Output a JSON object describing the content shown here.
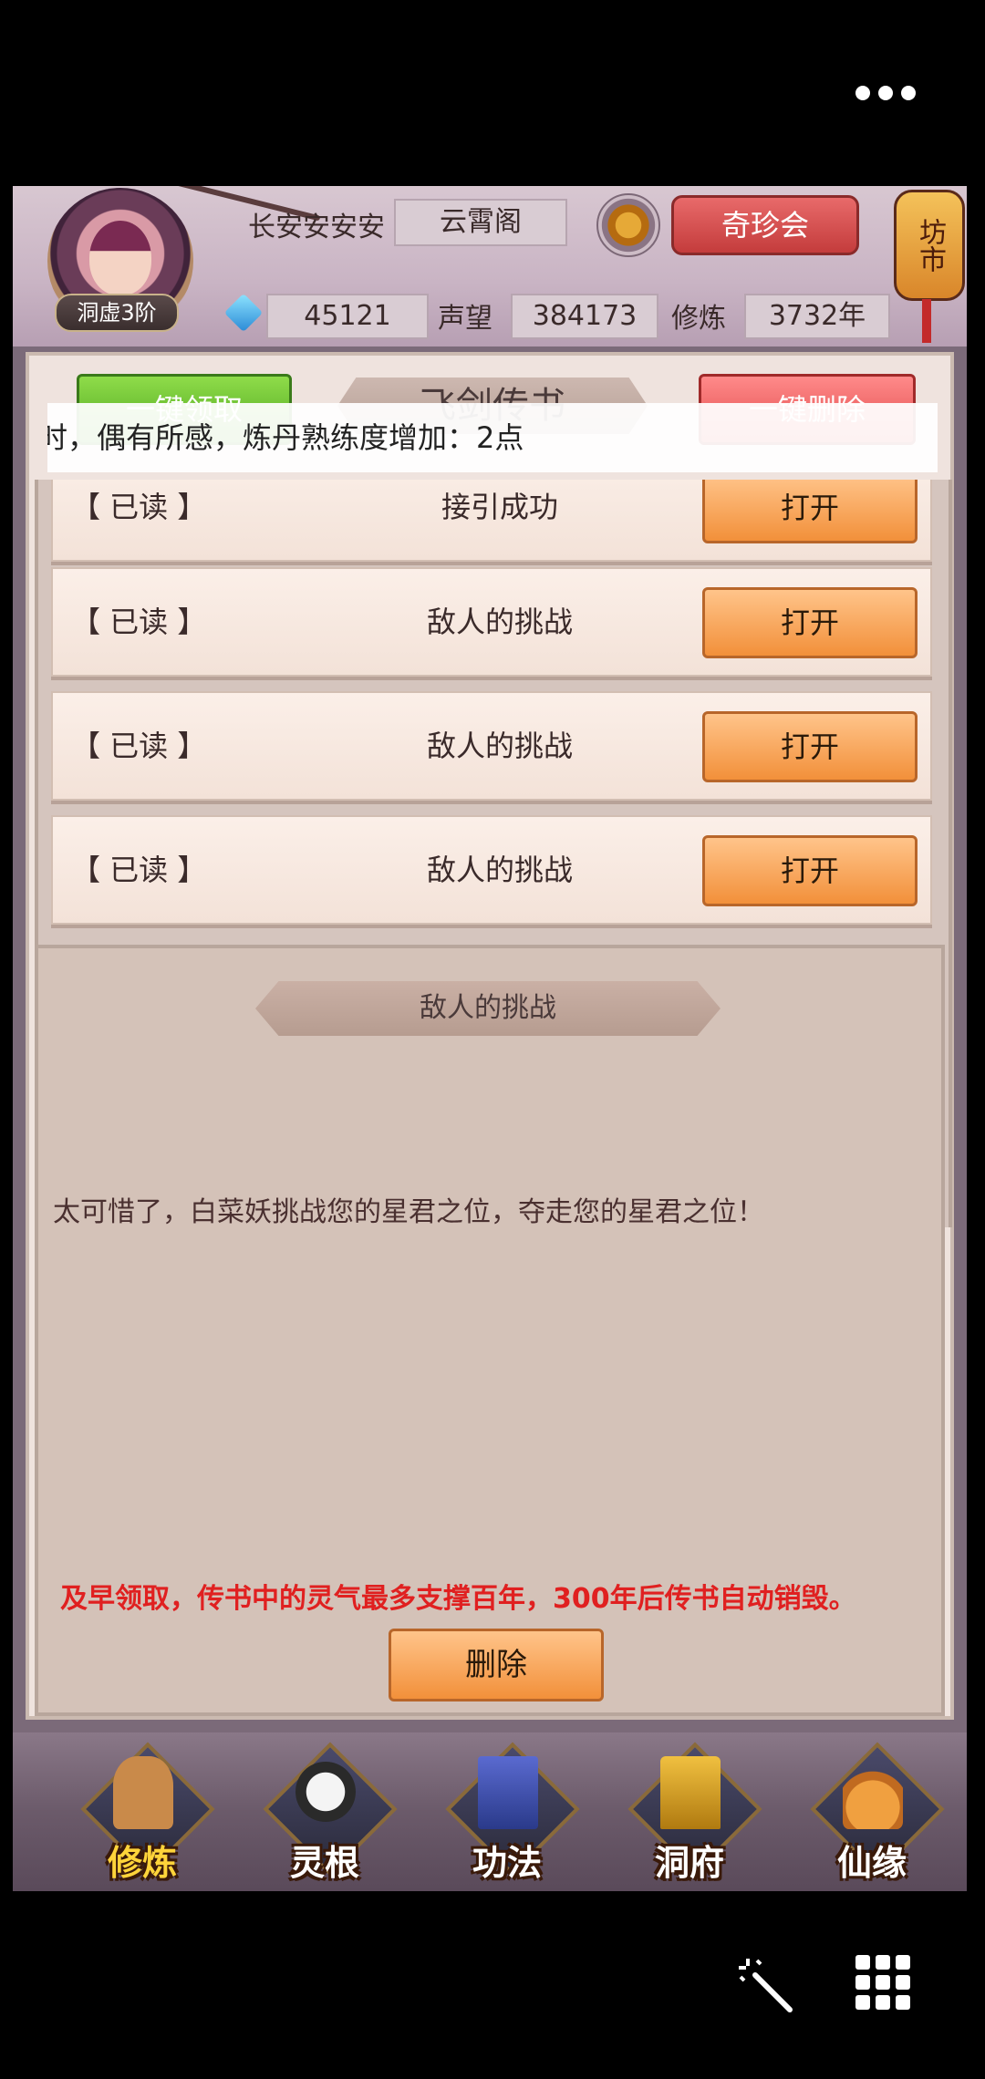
{
  "system": {
    "more_icon": "more-dots-icon"
  },
  "header": {
    "rank": "洞虚3阶",
    "player_name": "长安安安安",
    "guild": "云霄阁",
    "shop_button": "奇珍会",
    "market_label": "坊市",
    "spirit_stones": "45121",
    "prestige_label": "声望",
    "prestige": "384173",
    "cultivation_label": "修炼",
    "cultivation_years": "3732年"
  },
  "mail": {
    "title": "飞剑传书",
    "claim_all": "一键领取",
    "delete_all": "一键删除",
    "toast": "时，偶有所感，炼丹熟练度增加：2点",
    "items": [
      {
        "status": "【 已读 】",
        "subject": "接引成功",
        "action": "打开"
      },
      {
        "status": "【 已读 】",
        "subject": "敌人的挑战",
        "action": "打开"
      },
      {
        "status": "【 已读 】",
        "subject": "敌人的挑战",
        "action": "打开"
      },
      {
        "status": "【 已读 】",
        "subject": "敌人的挑战",
        "action": "打开"
      }
    ],
    "detail": {
      "title": "敌人的挑战",
      "body": "太可惜了，白菜妖挑战您的星君之位，夺走您的星君之位！",
      "warning": "及早领取，传书中的灵气最多支撑百年，300年后传书自动销毁。",
      "delete": "删除"
    }
  },
  "nav": [
    {
      "label": "修炼",
      "icon": "cultivation-icon",
      "color": "#c98a4a"
    },
    {
      "label": "灵根",
      "icon": "spirit-root-icon",
      "color": "#d0d0d0"
    },
    {
      "label": "功法",
      "icon": "technique-icon",
      "color": "#4a5ab0"
    },
    {
      "label": "洞府",
      "icon": "cave-dwelling-icon",
      "color": "#e0b030"
    },
    {
      "label": "仙缘",
      "icon": "immortal-fate-icon",
      "color": "#e08a30"
    }
  ],
  "colors": {
    "accent_orange": "#f2903a",
    "warning_red": "#e02020",
    "claim_green": "#4ea61e",
    "delete_red": "#e04a4a"
  }
}
